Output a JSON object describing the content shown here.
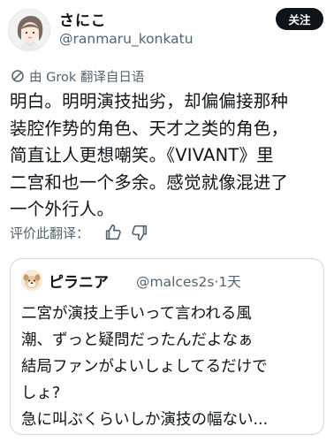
{
  "post": {
    "author_name": "さにこ",
    "author_handle": "@ranmaru_konkatu",
    "follow_label": "关注",
    "translated_label": "由 Grok 翻译自日语",
    "body_lines": [
      "明白。明明演技拙劣，却偏偏接那种",
      "装腔作势的角色、天才之类的角色，",
      "简直让人更想嘲笑。《VIVANT》里",
      "二宫和也一个多余。感觉就像混进了",
      "一个外行人。"
    ],
    "rate_label": "评价此翻译："
  },
  "quote": {
    "author_name": "ピラニア",
    "handle_and_time": "@malces2s·1天",
    "body_lines": [
      "二宮が演技上手いって言われる風",
      "潮、ずっと疑問だったんだよなぁ",
      "結局ファンがよいしょしてるだけで",
      "しょ?",
      "急に叫ぶくらいしか演技の幅ない..."
    ]
  },
  "icons": {
    "translate": "translate-icon",
    "thumbs_up": "thumbs-up-icon",
    "thumbs_down": "thumbs-down-icon"
  }
}
